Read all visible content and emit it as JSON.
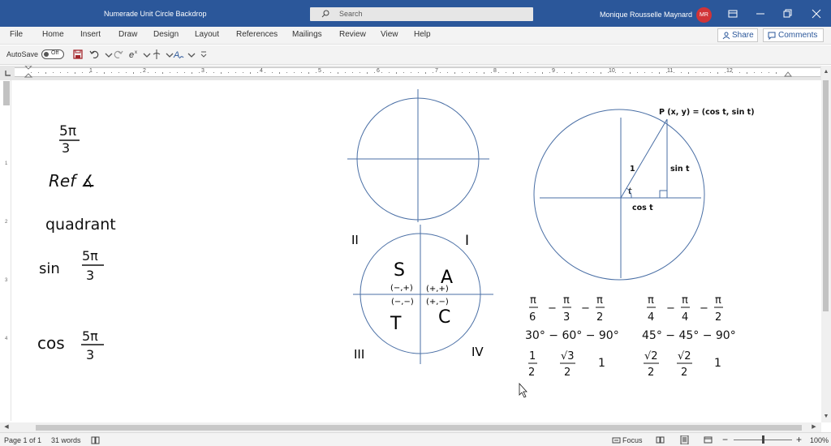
{
  "window": {
    "title": "Numerade Unit Circle Backdrop",
    "search_placeholder": "Search",
    "user_name": "Monique Rousselle Maynard",
    "user_initials": "MR",
    "title_bar_color": "#2b579a"
  },
  "ribbon_tabs": [
    "File",
    "Home",
    "Insert",
    "Draw",
    "Design",
    "Layout",
    "References",
    "Mailings",
    "Review",
    "View",
    "Help"
  ],
  "ribbon_actions": {
    "share": "Share",
    "comments": "Comments"
  },
  "qat": {
    "autosave_label": "AutoSave",
    "autosave_state": "Off",
    "icons": [
      "save-icon",
      "undo-icon",
      "redo-icon",
      "equation-icon",
      "ink-equation-icon",
      "text-effects-icon",
      "customize-qat-icon"
    ]
  },
  "ruler": {
    "numbers": [
      "1",
      "1",
      "2",
      "3",
      "4",
      "5",
      "6",
      "7",
      "8",
      "9",
      "10",
      "11",
      "12"
    ],
    "vertical_numbers": [
      "1",
      "2",
      "3",
      "4"
    ]
  },
  "document": {
    "handwriting": {
      "fraction_top": "5π",
      "fraction_bottom": "3",
      "ref_angle": "Ref ∡",
      "quadrant": "quadrant",
      "sin": "sin",
      "cos": "cos"
    },
    "quadrants": {
      "labels": [
        "II",
        "I",
        "III",
        "IV"
      ],
      "letters": [
        "S",
        "A",
        "T",
        "C"
      ],
      "signs": [
        "(−,+)",
        "(+,+)",
        "(−,−)",
        "(+,−)"
      ]
    },
    "unit_circle": {
      "point_label": "P (x, y) = (cos t, sin t)",
      "radius_label": "1",
      "angle_label": "t",
      "sin_label": "sin t",
      "cos_label": "cos t"
    },
    "triangles": {
      "set1_fracs": [
        [
          "π",
          "6"
        ],
        [
          "π",
          "3"
        ],
        [
          "π",
          "2"
        ]
      ],
      "set1_degrees": "30° − 60° − 90°",
      "set1_sides": [
        [
          "1",
          "2"
        ],
        [
          "√3",
          "2"
        ],
        [
          "1"
        ]
      ],
      "set2_fracs": [
        [
          "π",
          "4"
        ],
        [
          "π",
          "4"
        ],
        [
          "π",
          "2"
        ]
      ],
      "set2_degrees": "45° − 45° − 90°",
      "set2_sides": [
        [
          "√2",
          "2"
        ],
        [
          "√2",
          "2"
        ],
        [
          "1"
        ]
      ],
      "dash": "−"
    }
  },
  "status": {
    "page": "Page 1 of 1",
    "words": "31 words",
    "focus": "Focus",
    "zoom": "100%"
  }
}
